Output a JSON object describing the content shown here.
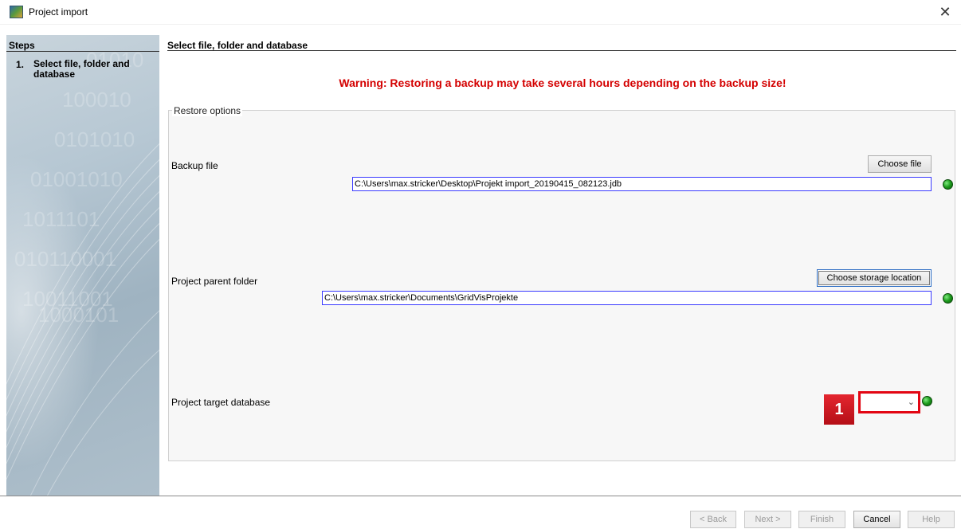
{
  "window": {
    "title": "Project import",
    "close_glyph": "✕"
  },
  "sidebar": {
    "title": "Steps",
    "steps": [
      {
        "number": "1.",
        "label": "Select file, folder and database"
      }
    ],
    "decoration_text": [
      "01010",
      "100010",
      "0101010",
      "01001010",
      "1011101",
      "010110001",
      "10011001",
      "1000101"
    ]
  },
  "main": {
    "title": "Select file, folder and database",
    "warning": "Warning: Restoring a backup may take several hours depending on the backup size!",
    "group_title": "Restore options",
    "backup": {
      "label": "Backup file",
      "button": "Choose file",
      "value": "C:\\Users\\max.stricker\\Desktop\\Projekt import_20190415_082123.jdb"
    },
    "parent_folder": {
      "label": "Project parent folder",
      "button": "Choose storage location",
      "value": "C:\\Users\\max.stricker\\Documents\\GridVisProjekte"
    },
    "target_db": {
      "label": "Project target database",
      "value": "",
      "arrow": "⌄"
    }
  },
  "annotation": {
    "badge": "1",
    "color": "#e30613"
  },
  "footer": {
    "back": "< Back",
    "next": "Next >",
    "finish": "Finish",
    "cancel": "Cancel",
    "help": "Help"
  },
  "colors": {
    "warning": "#d40000",
    "status_ok": "#1c9a1c",
    "field_border": "#3a3aff"
  },
  "icons": {
    "app": "gridvis-app-icon",
    "status": "green-led-icon"
  }
}
